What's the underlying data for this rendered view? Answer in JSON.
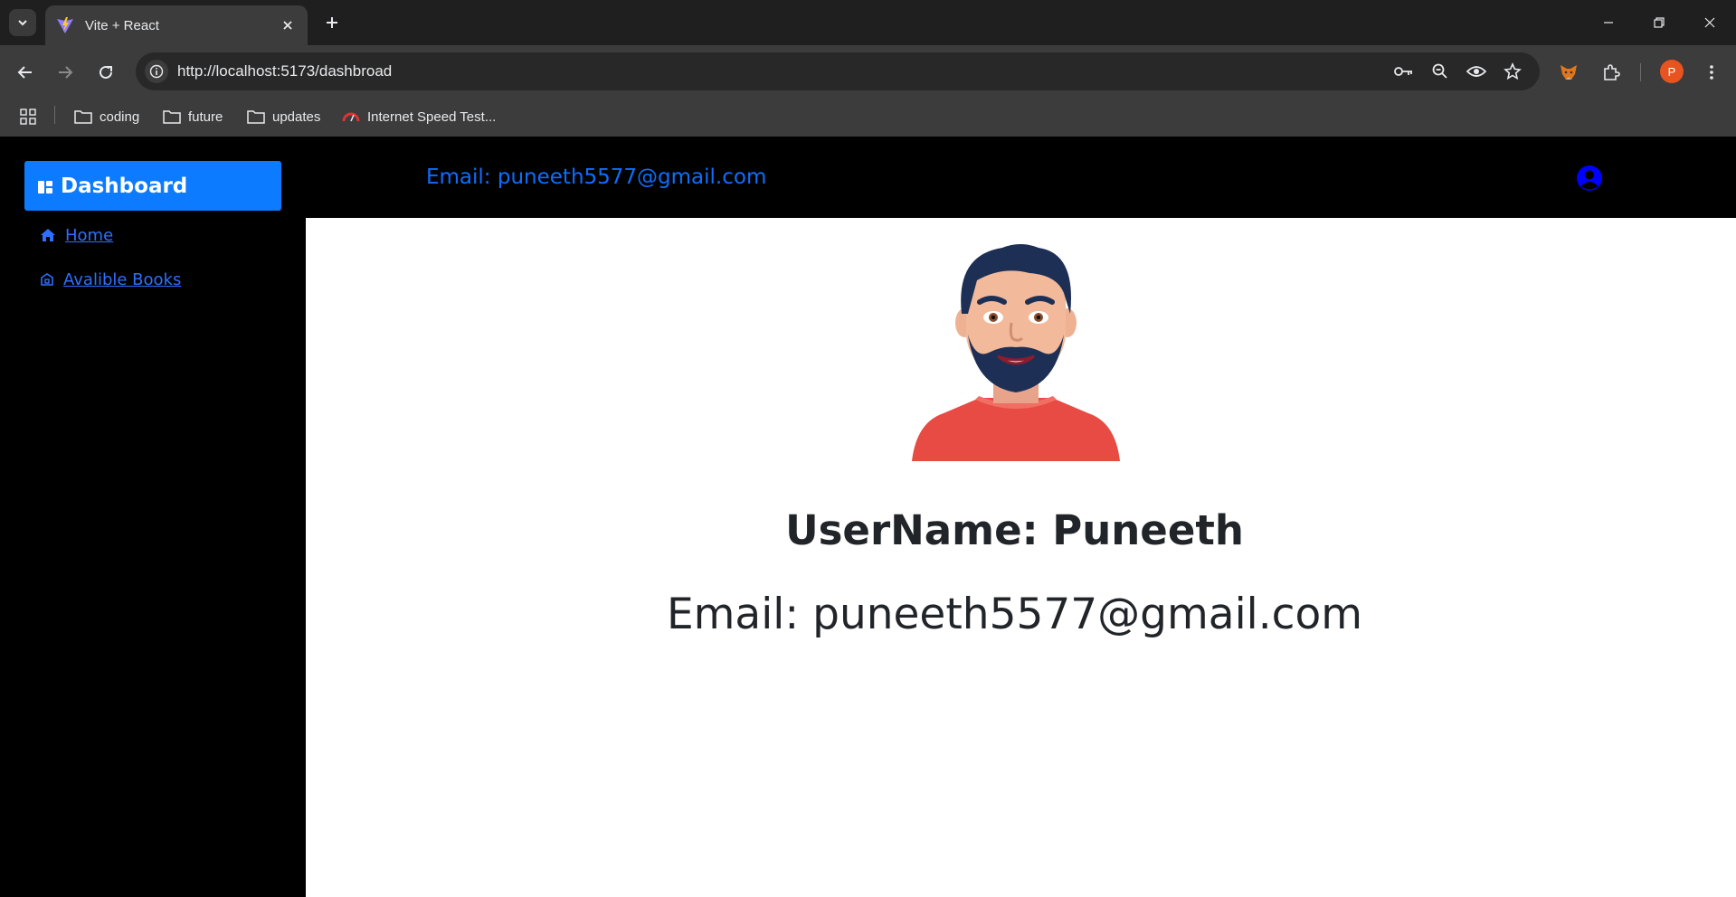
{
  "browser": {
    "tab_title": "Vite + React",
    "url": "http://localhost:5173/dashbroad",
    "profile_initial": "P",
    "bookmarks": [
      {
        "label": "coding",
        "icon": "folder-icon"
      },
      {
        "label": "future",
        "icon": "folder-icon"
      },
      {
        "label": "updates",
        "icon": "folder-icon"
      },
      {
        "label": "Internet Speed Test...",
        "icon": "speedometer-icon"
      }
    ]
  },
  "sidebar": {
    "dashboard_label": "Dashboard",
    "items": [
      {
        "label": "Home",
        "icon": "home-icon"
      },
      {
        "label": "Avalible Books",
        "icon": "bank-icon"
      }
    ]
  },
  "topbar": {
    "email": "Email: puneeth5577@gmail.com"
  },
  "profile": {
    "username": "UserName: Puneeth",
    "email": "Email: puneeth5577@gmail.com"
  },
  "colors": {
    "accent": "#0d7bff",
    "link": "#2f6fff",
    "top_email": "#0d6efd",
    "sidebar_bg": "#000000"
  }
}
